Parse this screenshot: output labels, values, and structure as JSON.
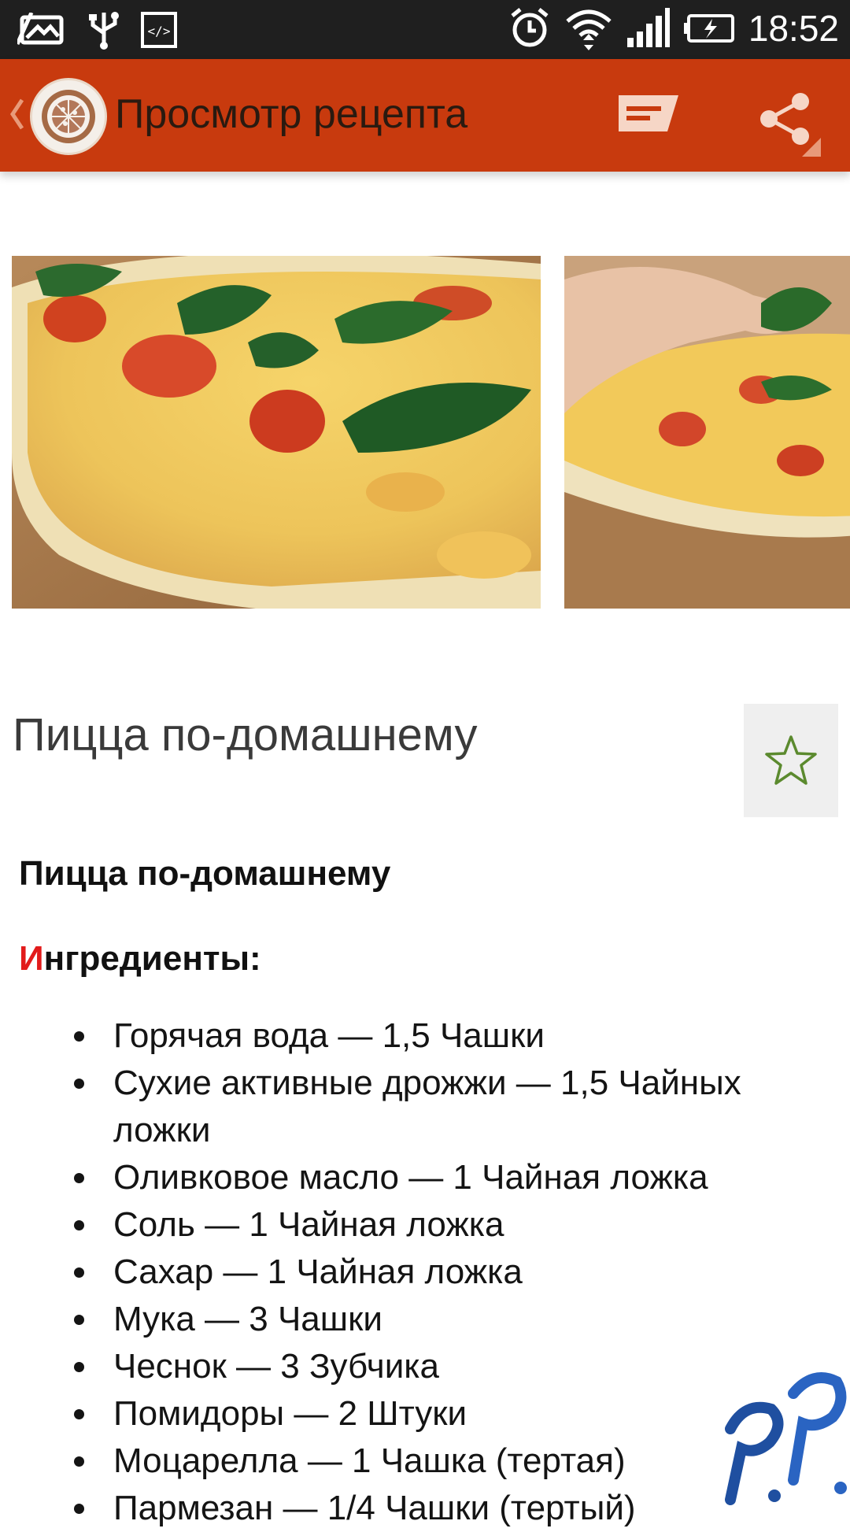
{
  "status_bar": {
    "time": "18:52",
    "icons": [
      "photo-notification-icon",
      "usb-icon",
      "developer-code-icon",
      "alarm-icon",
      "wifi-icon",
      "cell-signal-icon",
      "battery-charging-icon"
    ]
  },
  "app_bar": {
    "title": "Просмотр рецепта",
    "icons": [
      "back-chevron-icon",
      "pizza-logo-icon",
      "message-icon",
      "share-icon"
    ],
    "color": "#c83a0e"
  },
  "gallery": {
    "images": [
      "pizza-with-basil-photo",
      "hand-adding-basil-photo"
    ]
  },
  "recipe": {
    "title": "Пицца по-домашнему",
    "favorite_icon": "star-outline-icon",
    "subtitle": "Пицца по-домашнему",
    "ingredients_heading_first": "И",
    "ingredients_heading_rest": "нгредиенты:",
    "ingredients": [
      "Горячая вода — 1,5 Чашки",
      "Сухие активные дрожжи — 1,5 Чайных ложки",
      "Оливковое масло — 1 Чайная ложка",
      "Соль — 1 Чайная ложка",
      "Сахар — 1 Чайная ложка",
      "Мука — 3 Чашки",
      "Чеснок — 3 Зубчика",
      "Помидоры — 2 Штуки",
      "Моцарелла — 1 Чашка (тертая)",
      "Пармезан — 1/4 Чашки (тертый)"
    ]
  },
  "watermark": {
    "text": "P.P."
  }
}
